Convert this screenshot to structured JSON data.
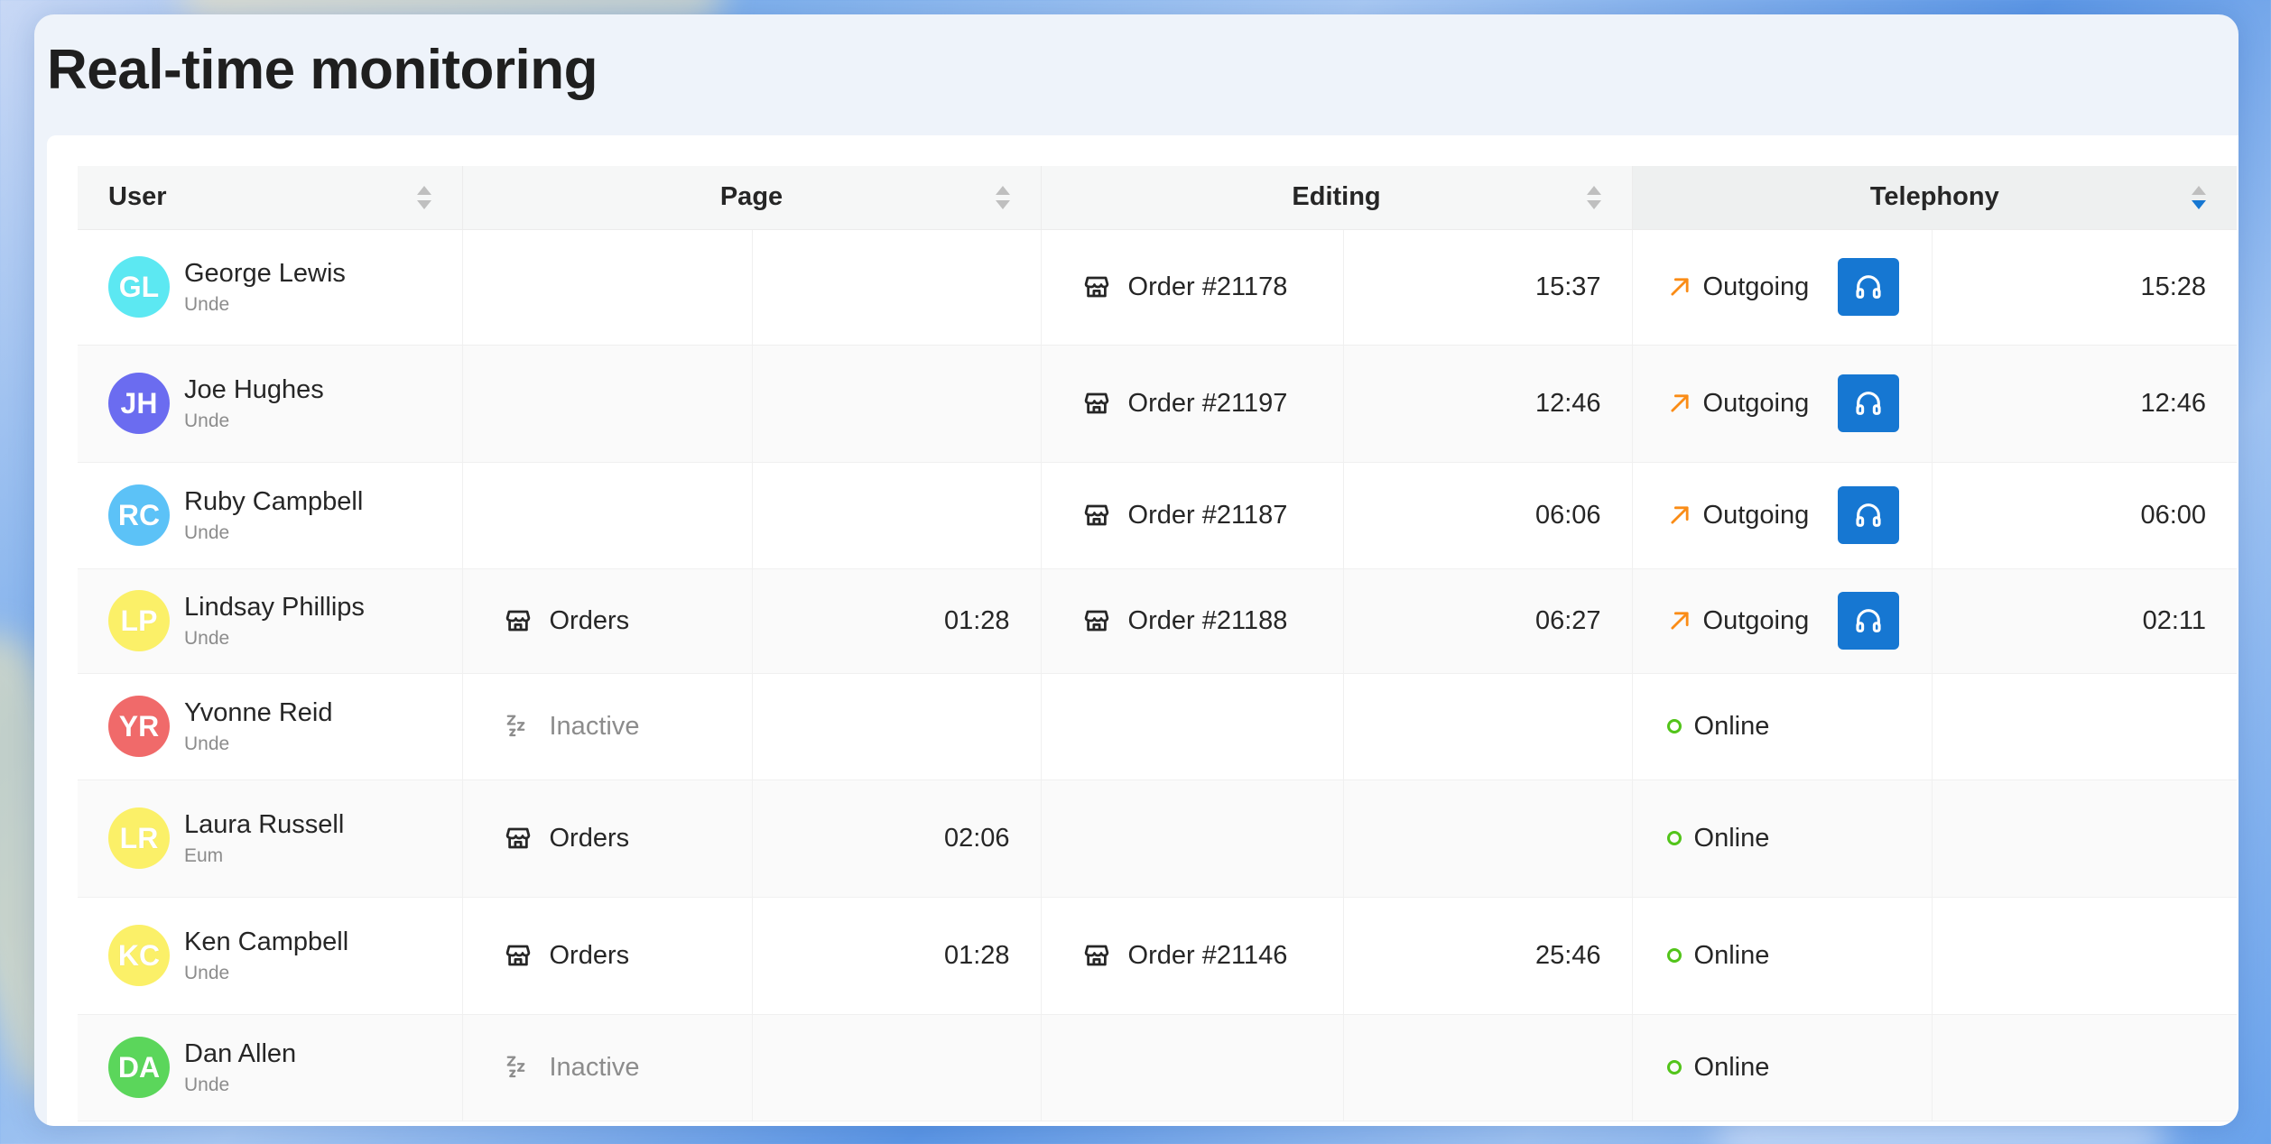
{
  "page": {
    "title": "Real-time monitoring"
  },
  "columns": [
    {
      "label": "User"
    },
    {
      "label": "Page"
    },
    {
      "label": "Editing"
    },
    {
      "label": "Telephony"
    }
  ],
  "colors": {
    "accent": "#1677d2",
    "outgoing": "#fa8c16",
    "online": "#52c41a"
  },
  "rows": [
    {
      "name": "George Lewis",
      "sub": "Unde",
      "initials": "GL",
      "color": "#5ce8f2",
      "page": "",
      "page_icon": "",
      "page_time": "",
      "edit": "Order #21178",
      "edit_time": "15:37",
      "tel": "Outgoing",
      "tel_type": "outgoing",
      "tel_time": "15:28",
      "height": 128
    },
    {
      "name": "Joe Hughes",
      "sub": "Unde",
      "initials": "JH",
      "color": "#6b6cf0",
      "page": "",
      "page_icon": "",
      "page_time": "",
      "edit": "Order #21197",
      "edit_time": "12:46",
      "tel": "Outgoing",
      "tel_type": "outgoing",
      "tel_time": "12:46",
      "height": 130
    },
    {
      "name": "Ruby Campbell",
      "sub": "Unde",
      "initials": "RC",
      "color": "#5cc2f7",
      "page": "",
      "page_icon": "",
      "page_time": "",
      "edit": "Order #21187",
      "edit_time": "06:06",
      "tel": "Outgoing",
      "tel_type": "outgoing",
      "tel_time": "06:00",
      "height": 118
    },
    {
      "name": "Lindsay Phillips",
      "sub": "Unde",
      "initials": "LP",
      "color": "#fbf068",
      "page": "Orders",
      "page_icon": "store-icon",
      "page_time": "01:28",
      "edit": "Order #21188",
      "edit_time": "06:27",
      "tel": "Outgoing",
      "tel_type": "outgoing",
      "tel_time": "02:11",
      "height": 116
    },
    {
      "name": "Yvonne Reid",
      "sub": "Unde",
      "initials": "YR",
      "color": "#f06a6a",
      "page": "Inactive",
      "page_icon": "sleep-icon",
      "page_time": "",
      "edit": "",
      "edit_time": "",
      "tel": "Online",
      "tel_type": "online",
      "tel_time": "",
      "height": 118
    },
    {
      "name": "Laura Russell",
      "sub": "Eum",
      "initials": "LR",
      "color": "#fbf068",
      "page": "Orders",
      "page_icon": "store-icon",
      "page_time": "02:06",
      "edit": "",
      "edit_time": "",
      "tel": "Online",
      "tel_type": "online",
      "tel_time": "",
      "height": 130
    },
    {
      "name": "Ken Campbell",
      "sub": "Unde",
      "initials": "KC",
      "color": "#fbf068",
      "page": "Orders",
      "page_icon": "store-icon",
      "page_time": "01:28",
      "edit": "Order #21146",
      "edit_time": "25:46",
      "tel": "Online",
      "tel_type": "online",
      "tel_time": "",
      "height": 130
    },
    {
      "name": "Dan Allen",
      "sub": "Unde",
      "initials": "DA",
      "color": "#5bd65b",
      "page": "Inactive",
      "page_icon": "sleep-icon",
      "page_time": "",
      "edit": "",
      "edit_time": "",
      "tel": "Online",
      "tel_type": "online",
      "tel_time": "",
      "height": 118
    }
  ]
}
